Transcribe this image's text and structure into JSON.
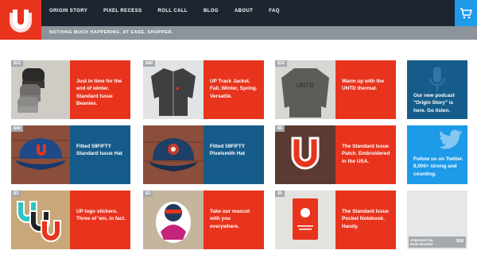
{
  "nav": {
    "items": [
      "ORIGIN STORY",
      "PIXEL RECESS",
      "ROLL CALL",
      "BLOG",
      "ABOUT",
      "FAQ"
    ]
  },
  "tagline": "NOTHING MUCH HAPPENING. AT EASE, SHOPPER.",
  "rows": [
    {
      "tiles": [
        {
          "price": "$22",
          "text": "Just in time for the end of winter. Standard Issue Beanies."
        },
        {
          "price": "$40",
          "text": "UP Track Jacket. Fall, Winter, Spring. Versatile."
        },
        {
          "price": "$32",
          "text": "Warm up with the UNTD thermal."
        },
        {
          "text": "Our new podcast \"Origin Story\" is here. Go listen."
        }
      ]
    },
    {
      "tiles": [
        {
          "price": "$40",
          "text": "Fitted 59FIFTY Standard Issue Hat"
        },
        {
          "price": "",
          "text": "Fitted 59FIFTY Pixelsmith Hat"
        },
        {
          "price": "$5",
          "text": "The Standard Issue Patch. Embroidered in the USA."
        },
        {
          "text": "Follow us on Twitter. 8,000+ strong and counting."
        }
      ]
    },
    {
      "tiles": [
        {
          "price": "$3",
          "text": "UP logo stickers. Three of 'em, in fact."
        },
        {
          "price": "$3",
          "text": "Take our mascot with you everywhere."
        },
        {
          "price": "$5",
          "text": "The Standard Issue Pocket Notebook. Handy."
        },
        {
          "credit": "Alignment by Evan Bremke",
          "price": "$28"
        }
      ]
    }
  ],
  "colors": {
    "brand_red": "#e8341d",
    "navy": "#165c8a",
    "twitter_blue": "#1d9ae8",
    "topbar": "#1c2530"
  },
  "icons": [
    "u-logo-icon",
    "cart-icon",
    "microphone-icon",
    "twitter-bird-icon"
  ]
}
